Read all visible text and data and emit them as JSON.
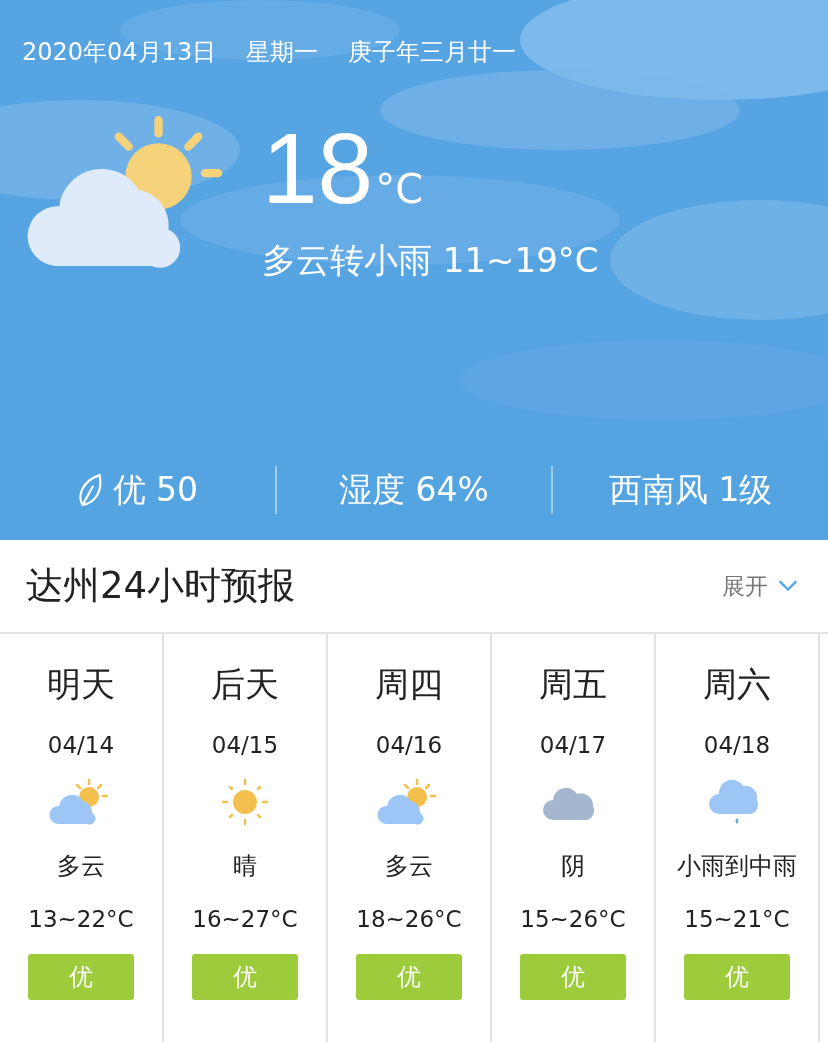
{
  "header": {
    "date": "2020年04月13日",
    "weekday": "星期一",
    "lunar": "庚子年三月廿一",
    "kind": "partly-cloudy",
    "temperature": "18",
    "unit": "°C",
    "summary": "多云转小雨 11~19°C"
  },
  "stats": [
    {
      "kind": "aqi",
      "text": "优 50"
    },
    {
      "kind": "plain",
      "text": "湿度 64%"
    },
    {
      "kind": "plain",
      "text": "西南风 1级"
    }
  ],
  "forecast": {
    "title": "达州24小时预报",
    "toggle": "展开",
    "expanded": false,
    "days": [
      {
        "day": "明天",
        "date": "04/14",
        "kind": "partly-cloudy",
        "condition": "多云",
        "range": "13~22°C",
        "aqi": "优"
      },
      {
        "day": "后天",
        "date": "04/15",
        "kind": "sunny",
        "condition": "晴",
        "range": "16~27°C",
        "aqi": "优"
      },
      {
        "day": "周四",
        "date": "04/16",
        "kind": "partly-cloudy",
        "condition": "多云",
        "range": "18~26°C",
        "aqi": "优"
      },
      {
        "day": "周五",
        "date": "04/17",
        "kind": "overcast",
        "condition": "阴",
        "range": "15~26°C",
        "aqi": "优"
      },
      {
        "day": "周六",
        "date": "04/18",
        "kind": "rain",
        "condition": "小雨到中雨",
        "range": "15~21°C",
        "aqi": "优"
      }
    ]
  }
}
